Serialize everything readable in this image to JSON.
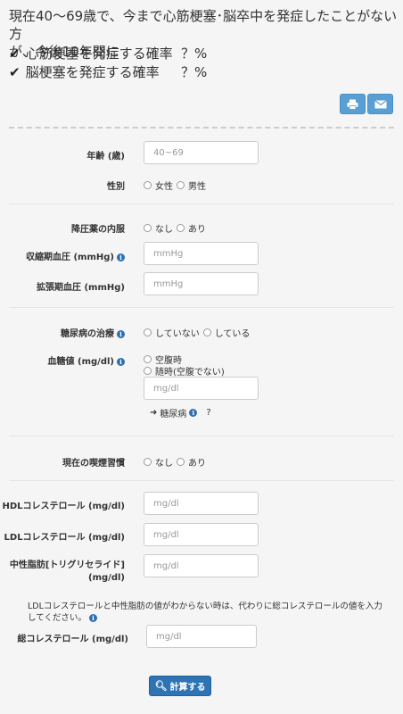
{
  "intro": {
    "line1": "現在40〜69歳で、今まで心筋梗塞･脳卒中を発症したことがない方",
    "line2": "が、今後10年間に",
    "items": [
      {
        "label": "心筋梗塞を発症する確率",
        "value": "？%"
      },
      {
        "label": "脳梗塞を発症する確率",
        "value": "？%"
      }
    ]
  },
  "toolbar": {
    "print_icon": "print-icon",
    "email_icon": "envelope-icon"
  },
  "form": {
    "age": {
      "label": "年齢 (歳)",
      "placeholder": "40~69"
    },
    "sex": {
      "label": "性別",
      "options": [
        "女性",
        "男性"
      ]
    },
    "bp_med": {
      "label": "降圧薬の内服",
      "options": [
        "なし",
        "あり"
      ]
    },
    "sbp": {
      "label": "収縮期血圧 (mmHg)",
      "placeholder": "mmHg"
    },
    "dbp": {
      "label": "拡張期血圧 (mmHg)",
      "placeholder": "mmHg"
    },
    "diabetes_tx": {
      "label": "糖尿病の治療",
      "options": [
        "していない",
        "している"
      ]
    },
    "glucose": {
      "label": "血糖値 (mg/dl)",
      "options": [
        "空腹時",
        "随時(空腹でない)"
      ],
      "placeholder": "mg/dl",
      "result_label": "糖尿病",
      "result_value": "?"
    },
    "smoking": {
      "label": "現在の喫煙習慣",
      "options": [
        "なし",
        "あり"
      ]
    },
    "hdl": {
      "label": "HDLコレステロール (mg/dl)",
      "placeholder": "mg/dl"
    },
    "ldl": {
      "label": "LDLコレステロール (mg/dl)",
      "placeholder": "mg/dl"
    },
    "tg": {
      "label_line1": "中性脂肪[トリグリセライド]",
      "label_line2": "(mg/dl)",
      "placeholder": "mg/dl"
    },
    "note": "LDLコレステロールと中性脂肪の値がわからない時は、代わりに総コレステロールの値を入力してください。",
    "total_chol": {
      "label": "総コレステロール (mg/dl)",
      "placeholder": "mg/dl"
    }
  },
  "calc_button": "計算する"
}
